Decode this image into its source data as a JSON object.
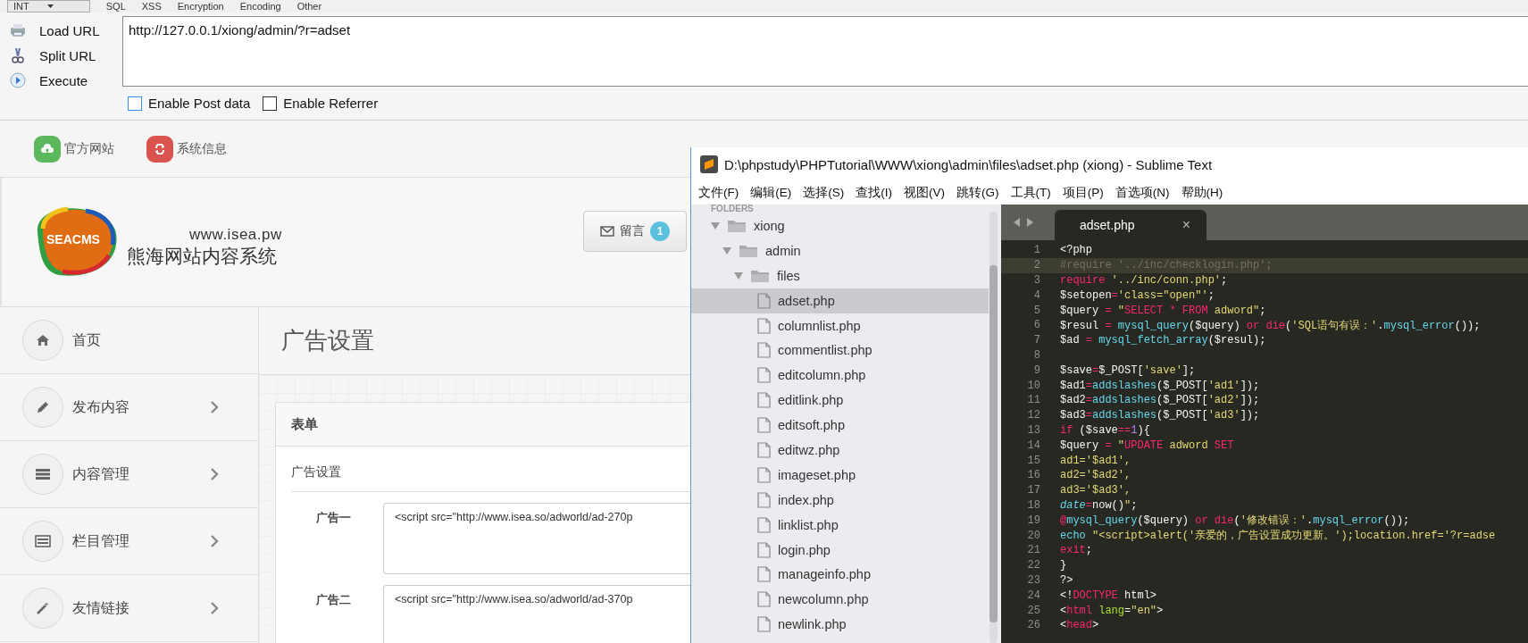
{
  "hackbar": {
    "menus": [
      {
        "label": "INT",
        "kind": "select"
      },
      {
        "label": "SQL",
        "kind": "menu"
      },
      {
        "label": "XSS",
        "kind": "menu"
      },
      {
        "label": "Encryption",
        "kind": "menu"
      },
      {
        "label": "Encoding",
        "kind": "menu"
      },
      {
        "label": "Other",
        "kind": "menu"
      }
    ],
    "actions": [
      {
        "label": "Load URL",
        "kind": "load"
      },
      {
        "label": "Split URL",
        "kind": "split"
      },
      {
        "label": "Execute",
        "kind": "execute"
      }
    ],
    "url": "http://127.0.0.1/xiong/admin/?r=adset",
    "options": [
      {
        "label": "Enable Post data",
        "checked": false,
        "focused": true
      },
      {
        "label": "Enable Referrer",
        "checked": false,
        "focused": false
      }
    ]
  },
  "cms": {
    "topbar": [
      {
        "label": "官方网站",
        "kind": "upload",
        "color": "#5cb85c"
      },
      {
        "label": "系统信息",
        "kind": "refresh",
        "color": "#d9534f"
      }
    ],
    "logo_text": "SEACMS",
    "site_url": "www.isea.pw",
    "site_name": "熊海网站内容系统",
    "message_button": {
      "label": "留言",
      "badge": "1"
    },
    "sidebar": [
      {
        "label": "首页",
        "expandable": false
      },
      {
        "label": "发布内容",
        "expandable": true
      },
      {
        "label": "内容管理",
        "expandable": true
      },
      {
        "label": "栏目管理",
        "expandable": true
      },
      {
        "label": "友情链接",
        "expandable": true
      }
    ],
    "page_title": "广告设置",
    "panel": {
      "title": "表单",
      "section": "广告设置",
      "fields": [
        {
          "label": "广告一",
          "value": "<script src=\"http://www.isea.so/adworld/ad-270p"
        },
        {
          "label": "广告二",
          "value": "<script src=\"http://www.isea.so/adworld/ad-370p"
        }
      ]
    }
  },
  "editor": {
    "title": "D:\\phpstudy\\PHPTutorial\\WWW\\xiong\\admin\\files\\adset.php (xiong) - Sublime Text",
    "menu": [
      "文件(F)",
      "编辑(E)",
      "选择(S)",
      "查找(I)",
      "视图(V)",
      "跳转(G)",
      "工具(T)",
      "项目(P)",
      "首选项(N)",
      "帮助(H)"
    ],
    "sidebar_header": "FOLDERS",
    "tree": [
      {
        "name": "xiong",
        "kind": "folder",
        "expanded": true,
        "children": [
          {
            "name": "admin",
            "kind": "folder",
            "expanded": true,
            "children": [
              {
                "name": "files",
                "kind": "folder",
                "expanded": true,
                "children": [
                  {
                    "name": "adset.php",
                    "kind": "file",
                    "selected": true
                  },
                  {
                    "name": "columnlist.php",
                    "kind": "file",
                    "selected": false
                  },
                  {
                    "name": "commentlist.php",
                    "kind": "file",
                    "selected": false
                  },
                  {
                    "name": "editcolumn.php",
                    "kind": "file",
                    "selected": false
                  },
                  {
                    "name": "editlink.php",
                    "kind": "file",
                    "selected": false
                  },
                  {
                    "name": "editsoft.php",
                    "kind": "file",
                    "selected": false
                  },
                  {
                    "name": "editwz.php",
                    "kind": "file",
                    "selected": false
                  },
                  {
                    "name": "imageset.php",
                    "kind": "file",
                    "selected": false
                  },
                  {
                    "name": "index.php",
                    "kind": "file",
                    "selected": false
                  },
                  {
                    "name": "linklist.php",
                    "kind": "file",
                    "selected": false
                  },
                  {
                    "name": "login.php",
                    "kind": "file",
                    "selected": false
                  },
                  {
                    "name": "manageinfo.php",
                    "kind": "file",
                    "selected": false
                  },
                  {
                    "name": "newcolumn.php",
                    "kind": "file",
                    "selected": false
                  },
                  {
                    "name": "newlink.php",
                    "kind": "file",
                    "selected": false
                  }
                ]
              }
            ]
          }
        ]
      }
    ],
    "tab": {
      "label": "adset.php",
      "close": "×"
    },
    "lines": [
      {
        "number": "1",
        "current": false,
        "tokens": [
          {
            "kind": "plain",
            "text": "<?php"
          }
        ]
      },
      {
        "number": "2",
        "current": true,
        "tokens": [
          {
            "kind": "comment",
            "text": "#require '../inc/checklogin.php';"
          }
        ]
      },
      {
        "number": "3",
        "current": false,
        "tokens": [
          {
            "kind": "keyword",
            "text": "require"
          },
          {
            "kind": "string",
            "text": " '../inc/conn.php'"
          },
          {
            "kind": "plain",
            "text": ";"
          }
        ]
      },
      {
        "number": "4",
        "current": false,
        "tokens": [
          {
            "kind": "plain",
            "text": "$setopen"
          },
          {
            "kind": "keyword",
            "text": "="
          },
          {
            "kind": "string",
            "text": "'class=\"open\"'"
          },
          {
            "kind": "plain",
            "text": ";"
          }
        ]
      },
      {
        "number": "5",
        "current": false,
        "tokens": [
          {
            "kind": "plain",
            "text": "$query "
          },
          {
            "kind": "keyword",
            "text": "="
          },
          {
            "kind": "string",
            "text": " \""
          },
          {
            "kind": "keyword",
            "text": "SELECT * FROM"
          },
          {
            "kind": "string",
            "text": " adword\""
          },
          {
            "kind": "plain",
            "text": ";"
          }
        ]
      },
      {
        "number": "6",
        "current": false,
        "tokens": [
          {
            "kind": "plain",
            "text": "$resul "
          },
          {
            "kind": "keyword",
            "text": "="
          },
          {
            "kind": "function",
            "text": " mysql_query"
          },
          {
            "kind": "plain",
            "text": "($query) "
          },
          {
            "kind": "keyword",
            "text": "or die"
          },
          {
            "kind": "plain",
            "text": "("
          },
          {
            "kind": "string",
            "text": "'SQL语句有误：'"
          },
          {
            "kind": "plain",
            "text": "."
          },
          {
            "kind": "function",
            "text": "mysql_error"
          },
          {
            "kind": "plain",
            "text": "());"
          }
        ]
      },
      {
        "number": "7",
        "current": false,
        "tokens": [
          {
            "kind": "plain",
            "text": "$ad "
          },
          {
            "kind": "keyword",
            "text": "="
          },
          {
            "kind": "function",
            "text": " mysql_fetch_array"
          },
          {
            "kind": "plain",
            "text": "($resul);"
          }
        ]
      },
      {
        "number": "8",
        "current": false
      },
      {
        "number": "9",
        "current": false,
        "tokens": [
          {
            "kind": "plain",
            "text": "$save"
          },
          {
            "kind": "keyword",
            "text": "="
          },
          {
            "kind": "plain",
            "text": "$_POST["
          },
          {
            "kind": "string",
            "text": "'save'"
          },
          {
            "kind": "plain",
            "text": "];"
          }
        ]
      },
      {
        "number": "10",
        "current": false,
        "tokens": [
          {
            "kind": "plain",
            "text": "$ad1"
          },
          {
            "kind": "keyword",
            "text": "="
          },
          {
            "kind": "function",
            "text": "addslashes"
          },
          {
            "kind": "plain",
            "text": "($_POST["
          },
          {
            "kind": "string",
            "text": "'ad1'"
          },
          {
            "kind": "plain",
            "text": "]);"
          }
        ]
      },
      {
        "number": "11",
        "current": false,
        "tokens": [
          {
            "kind": "plain",
            "text": "$ad2"
          },
          {
            "kind": "keyword",
            "text": "="
          },
          {
            "kind": "function",
            "text": "addslashes"
          },
          {
            "kind": "plain",
            "text": "($_POST["
          },
          {
            "kind": "string",
            "text": "'ad2'"
          },
          {
            "kind": "plain",
            "text": "]);"
          }
        ]
      },
      {
        "number": "12",
        "current": false,
        "tokens": [
          {
            "kind": "plain",
            "text": "$ad3"
          },
          {
            "kind": "keyword",
            "text": "="
          },
          {
            "kind": "function",
            "text": "addslashes"
          },
          {
            "kind": "plain",
            "text": "($_POST["
          },
          {
            "kind": "string",
            "text": "'ad3'"
          },
          {
            "kind": "plain",
            "text": "]);"
          }
        ]
      },
      {
        "number": "13",
        "current": false,
        "tokens": [
          {
            "kind": "keyword",
            "text": "if"
          },
          {
            "kind": "plain",
            "text": " ($save"
          },
          {
            "kind": "keyword",
            "text": "=="
          },
          {
            "kind": "number",
            "text": "1"
          },
          {
            "kind": "plain",
            "text": "){"
          }
        ]
      },
      {
        "number": "14",
        "current": false,
        "tokens": [
          {
            "kind": "plain",
            "text": "$query "
          },
          {
            "kind": "keyword",
            "text": "="
          },
          {
            "kind": "string",
            "text": " \""
          },
          {
            "kind": "keyword",
            "text": "UPDATE"
          },
          {
            "kind": "string",
            "text": " adword "
          },
          {
            "kind": "keyword",
            "text": "SET"
          }
        ]
      },
      {
        "number": "15",
        "current": false,
        "tokens": [
          {
            "kind": "string",
            "text": "ad1='$ad1',"
          }
        ]
      },
      {
        "number": "16",
        "current": false,
        "tokens": [
          {
            "kind": "string",
            "text": "ad2='$ad2',"
          }
        ]
      },
      {
        "number": "17",
        "current": false,
        "tokens": [
          {
            "kind": "string",
            "text": "ad3='$ad3',"
          }
        ]
      },
      {
        "number": "18",
        "current": false,
        "tokens": [
          {
            "kind": "type",
            "text": "date"
          },
          {
            "kind": "keyword",
            "text": "="
          },
          {
            "kind": "plain",
            "text": "now()"
          },
          {
            "kind": "string",
            "text": "\""
          },
          {
            "kind": "plain",
            "text": ";"
          }
        ]
      },
      {
        "number": "19",
        "current": false,
        "tokens": [
          {
            "kind": "keyword",
            "text": "@"
          },
          {
            "kind": "function",
            "text": "mysql_query"
          },
          {
            "kind": "plain",
            "text": "($query) "
          },
          {
            "kind": "keyword",
            "text": "or die"
          },
          {
            "kind": "plain",
            "text": "("
          },
          {
            "kind": "string",
            "text": "'修改错误：'"
          },
          {
            "kind": "plain",
            "text": "."
          },
          {
            "kind": "function",
            "text": "mysql_error"
          },
          {
            "kind": "plain",
            "text": "());"
          }
        ]
      },
      {
        "number": "20",
        "current": false,
        "tokens": [
          {
            "kind": "function",
            "text": "echo"
          },
          {
            "kind": "string",
            "text": " \"<script>alert('亲爱的，广告设置成功更新。');location.href='?r=adse"
          }
        ]
      },
      {
        "number": "21",
        "current": false,
        "tokens": [
          {
            "kind": "keyword",
            "text": "exit"
          },
          {
            "kind": "plain",
            "text": ";"
          }
        ]
      },
      {
        "number": "22",
        "current": false,
        "tokens": [
          {
            "kind": "plain",
            "text": "}"
          }
        ]
      },
      {
        "number": "23",
        "current": false,
        "tokens": [
          {
            "kind": "plain",
            "text": "?>"
          }
        ]
      },
      {
        "number": "24",
        "current": false,
        "tokens": [
          {
            "kind": "plain",
            "text": "<!"
          },
          {
            "kind": "keyword",
            "text": "DOCTYPE"
          },
          {
            "kind": "plain",
            "text": " html>"
          }
        ]
      },
      {
        "number": "25",
        "current": false,
        "tokens": [
          {
            "kind": "plain",
            "text": "<"
          },
          {
            "kind": "keyword",
            "text": "html"
          },
          {
            "kind": "attr",
            "text": " lang"
          },
          {
            "kind": "plain",
            "text": "="
          },
          {
            "kind": "string",
            "text": "\"en\""
          },
          {
            "kind": "plain",
            "text": ">"
          }
        ]
      },
      {
        "number": "26",
        "current": false,
        "tokens": [
          {
            "kind": "plain",
            "text": "<"
          },
          {
            "kind": "keyword",
            "text": "head"
          },
          {
            "kind": "plain",
            "text": ">"
          }
        ]
      }
    ]
  }
}
